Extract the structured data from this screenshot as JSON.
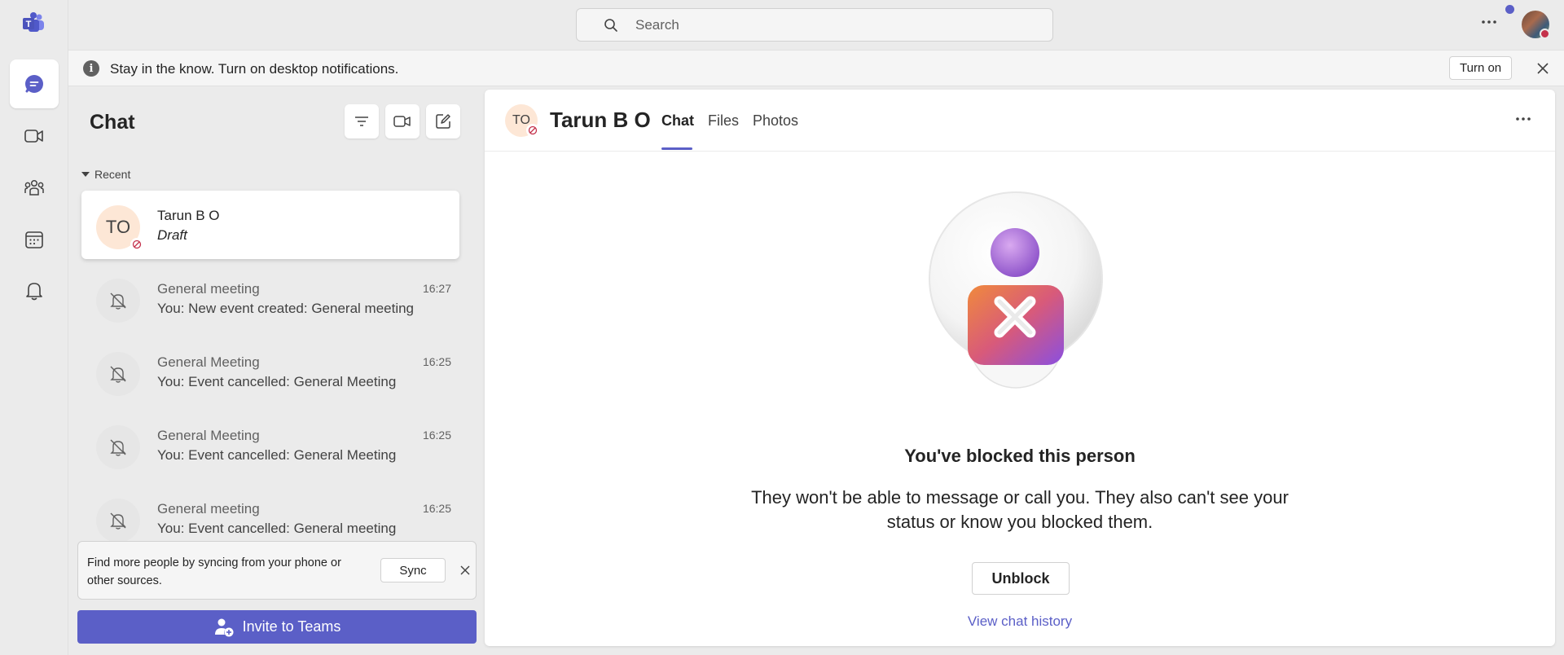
{
  "search": {
    "placeholder": "Search"
  },
  "banner": {
    "text": "Stay in the know. Turn on desktop notifications.",
    "button": "Turn on"
  },
  "chatlist": {
    "title": "Chat",
    "section": "Recent",
    "items": [
      {
        "initials": "TO",
        "name": "Tarun B O",
        "subtitle": "Draft",
        "time": ""
      },
      {
        "name": "General meeting",
        "subtitle": "You: New event created: General meeting",
        "time": "16:27"
      },
      {
        "name": "General Meeting",
        "subtitle": "You: Event cancelled: General Meeting",
        "time": "16:25"
      },
      {
        "name": "General Meeting",
        "subtitle": "You: Event cancelled: General Meeting",
        "time": "16:25"
      },
      {
        "name": "General meeting",
        "subtitle": "You: Event cancelled: General meeting",
        "time": "16:25"
      }
    ],
    "sync": {
      "text": "Find more people by syncing from your phone or other sources.",
      "button": "Sync"
    },
    "invite": "Invite to Teams"
  },
  "main": {
    "initials": "TO",
    "name": "Tarun B O",
    "tabs": [
      "Chat",
      "Files",
      "Photos"
    ],
    "blocked_title": "You've blocked this person",
    "blocked_desc": "They won't be able to message or call you. They also can't see your status or know you blocked them.",
    "unblock": "Unblock",
    "history": "View chat history"
  },
  "colors": {
    "accent": "#5b5fc7",
    "avatar_bg": "#fde7d6",
    "blocked_red": "#c4314b"
  }
}
